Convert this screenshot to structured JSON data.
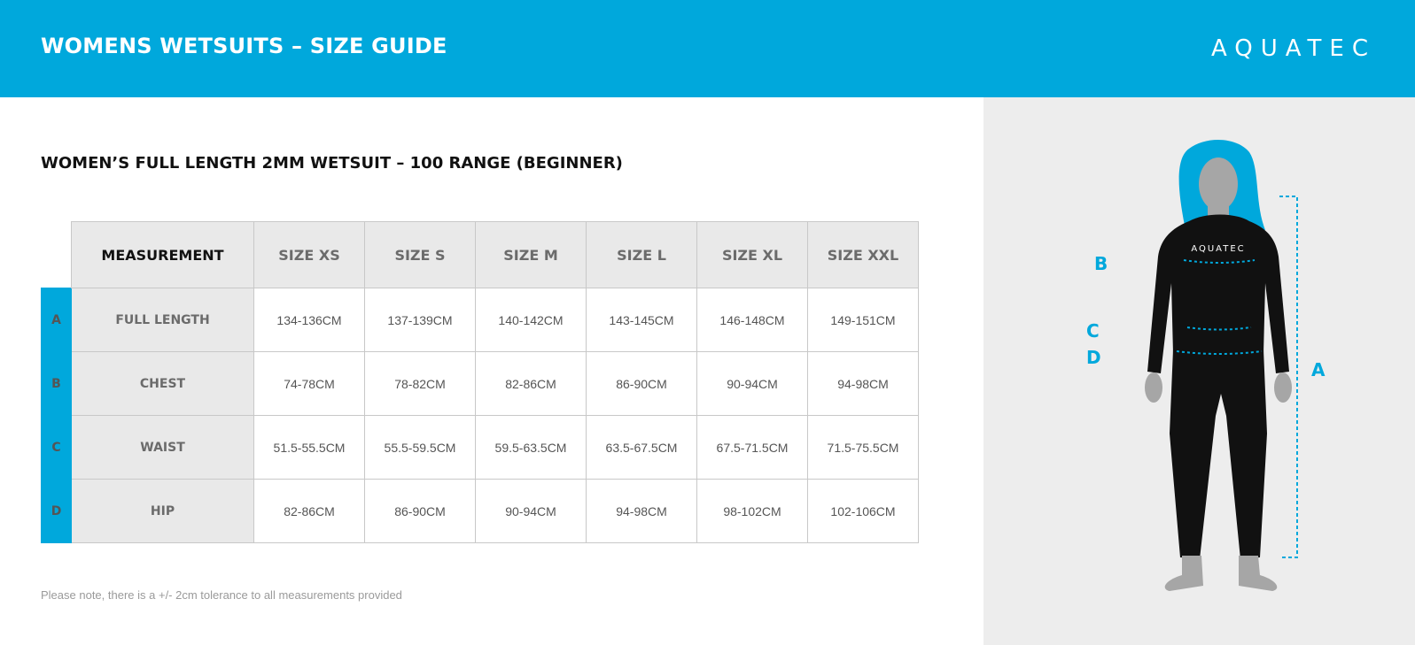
{
  "header": {
    "title": "WOMENS WETSUITS – SIZE GUIDE",
    "logo": "AQUATEC"
  },
  "section_title": "WOMEN’S FULL LENGTH 2MM WETSUIT – 100 RANGE (BEGINNER)",
  "table": {
    "measurement_header": "MEASUREMENT",
    "sizes": [
      "SIZE XS",
      "SIZE S",
      "SIZE M",
      "SIZE L",
      "SIZE XL",
      "SIZE XXL"
    ],
    "rows": [
      {
        "letter": "A",
        "label": "FULL LENGTH",
        "values": [
          "134-136CM",
          "137-139CM",
          "140-142CM",
          "143-145CM",
          "146-148CM",
          "149-151CM"
        ]
      },
      {
        "letter": "B",
        "label": "CHEST",
        "values": [
          "74-78CM",
          "78-82CM",
          "82-86CM",
          "86-90CM",
          "90-94CM",
          "94-98CM"
        ]
      },
      {
        "letter": "C",
        "label": "WAIST",
        "values": [
          "51.5-55.5CM",
          "55.5-59.5CM",
          "59.5-63.5CM",
          "63.5-67.5CM",
          "67.5-71.5CM",
          "71.5-75.5CM"
        ]
      },
      {
        "letter": "D",
        "label": "HIP",
        "values": [
          "82-86CM",
          "86-90CM",
          "90-94CM",
          "94-98CM",
          "98-102CM",
          "102-106CM"
        ]
      }
    ]
  },
  "note": "Please note, there is a +/- 2cm tolerance to all measurements provided",
  "figure": {
    "suit_logo": "AQUATEC",
    "labels": {
      "a": "A",
      "b": "B",
      "c": "C",
      "d": "D"
    }
  },
  "colors": {
    "accent": "#00a8dc",
    "panel": "#ededed",
    "suit": "#111111",
    "skin": "#a6a6a6"
  }
}
